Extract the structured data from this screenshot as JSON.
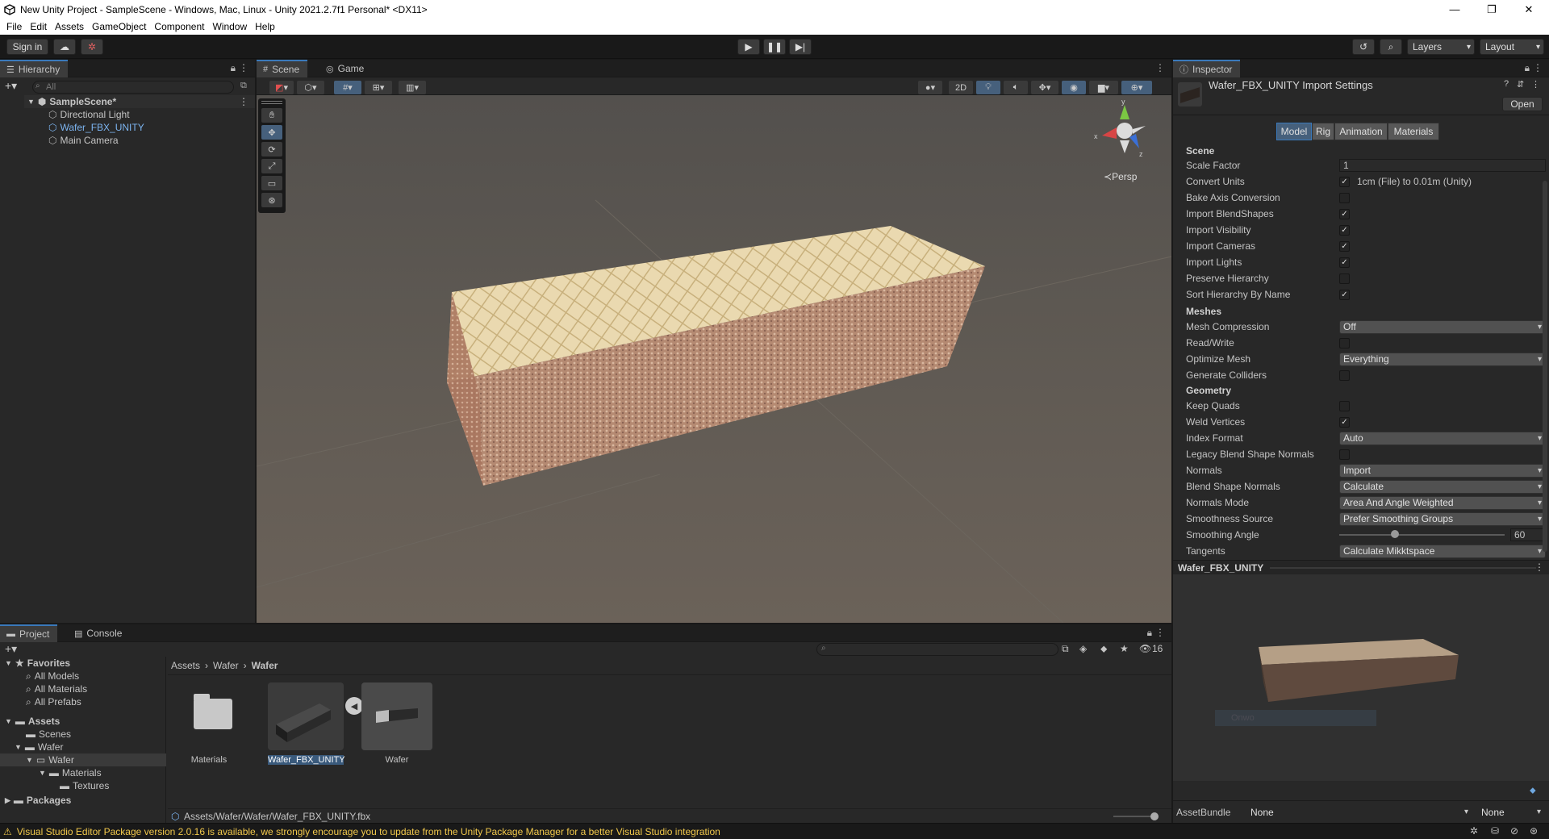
{
  "window": {
    "title": "New Unity Project - SampleScene - Windows, Mac, Linux - Unity 2021.2.7f1 Personal* <DX11>",
    "minimize": "—",
    "maximize": "❐",
    "close": "✕"
  },
  "menu": [
    "File",
    "Edit",
    "Assets",
    "GameObject",
    "Component",
    "Window",
    "Help"
  ],
  "toolbar": {
    "sign_in": "Sign in",
    "layers": "Layers",
    "layout": "Layout"
  },
  "hierarchy": {
    "tab": "Hierarchy",
    "search_placeholder": "All",
    "scene": "SampleScene*",
    "items": [
      "Directional Light",
      "Wafer_FBX_UNITY",
      "Main Camera"
    ]
  },
  "scene": {
    "tabs": [
      "Scene",
      "Game"
    ],
    "btn_2d": "2D",
    "persp": "Persp",
    "gizmo_y": "y",
    "gizmo_x": "x",
    "gizmo_z": "z"
  },
  "inspector": {
    "tab": "Inspector",
    "title": "Wafer_FBX_UNITY Import Settings",
    "open": "Open",
    "tabs": [
      "Model",
      "Rig",
      "Animation",
      "Materials"
    ],
    "section_scene": "Scene",
    "scale_factor_label": "Scale Factor",
    "scale_factor_value": "1",
    "convert_units_label": "Convert Units",
    "convert_units_note": "1cm (File) to 0.01m (Unity)",
    "bake_axis": "Bake Axis Conversion",
    "import_blendshapes": "Import BlendShapes",
    "import_visibility": "Import Visibility",
    "import_cameras": "Import Cameras",
    "import_lights": "Import Lights",
    "preserve_hierarchy": "Preserve Hierarchy",
    "sort_hierarchy": "Sort Hierarchy By Name",
    "section_meshes": "Meshes",
    "mesh_compression_label": "Mesh Compression",
    "mesh_compression_value": "Off",
    "read_write": "Read/Write",
    "optimize_mesh_label": "Optimize Mesh",
    "optimize_mesh_value": "Everything",
    "generate_colliders": "Generate Colliders",
    "section_geometry": "Geometry",
    "keep_quads": "Keep Quads",
    "weld_vertices": "Weld Vertices",
    "index_format_label": "Index Format",
    "index_format_value": "Auto",
    "legacy_blend": "Legacy Blend Shape Normals",
    "normals_label": "Normals",
    "normals_value": "Import",
    "blend_normals_label": "Blend Shape Normals",
    "blend_normals_value": "Calculate",
    "normals_mode_label": "Normals Mode",
    "normals_mode_value": "Area And Angle Weighted",
    "smoothness_label": "Smoothness Source",
    "smoothness_value": "Prefer Smoothing Groups",
    "smoothing_angle_label": "Smoothing Angle",
    "smoothing_angle_value": "60",
    "tangents_label": "Tangents",
    "tangents_value": "Calculate Mikktspace",
    "preview_title": "Wafer_FBX_UNITY",
    "preview_overlay": "Onwo",
    "assetbundle_label": "AssetBundle",
    "assetbundle_value": "None",
    "assetbundle_variant": "None"
  },
  "project": {
    "tabs": [
      "Project",
      "Console"
    ],
    "favorites": "Favorites",
    "fav_items": [
      "All Models",
      "All Materials",
      "All Prefabs"
    ],
    "assets": "Assets",
    "tree": [
      "Scenes",
      "Wafer",
      "Wafer",
      "Materials",
      "Textures"
    ],
    "packages": "Packages",
    "breadcrumb": [
      "Assets",
      "Wafer",
      "Wafer"
    ],
    "grid_items": [
      "Materials",
      "Wafer_FBX_UNITY",
      "Wafer"
    ],
    "path": "Assets/Wafer/Wafer/Wafer_FBX_UNITY.fbx",
    "count": "16"
  },
  "status": {
    "warning": "Visual Studio Editor Package version 2.0.16 is available, we strongly encourage you to update from the Unity Package Manager for a better Visual Studio integration"
  }
}
